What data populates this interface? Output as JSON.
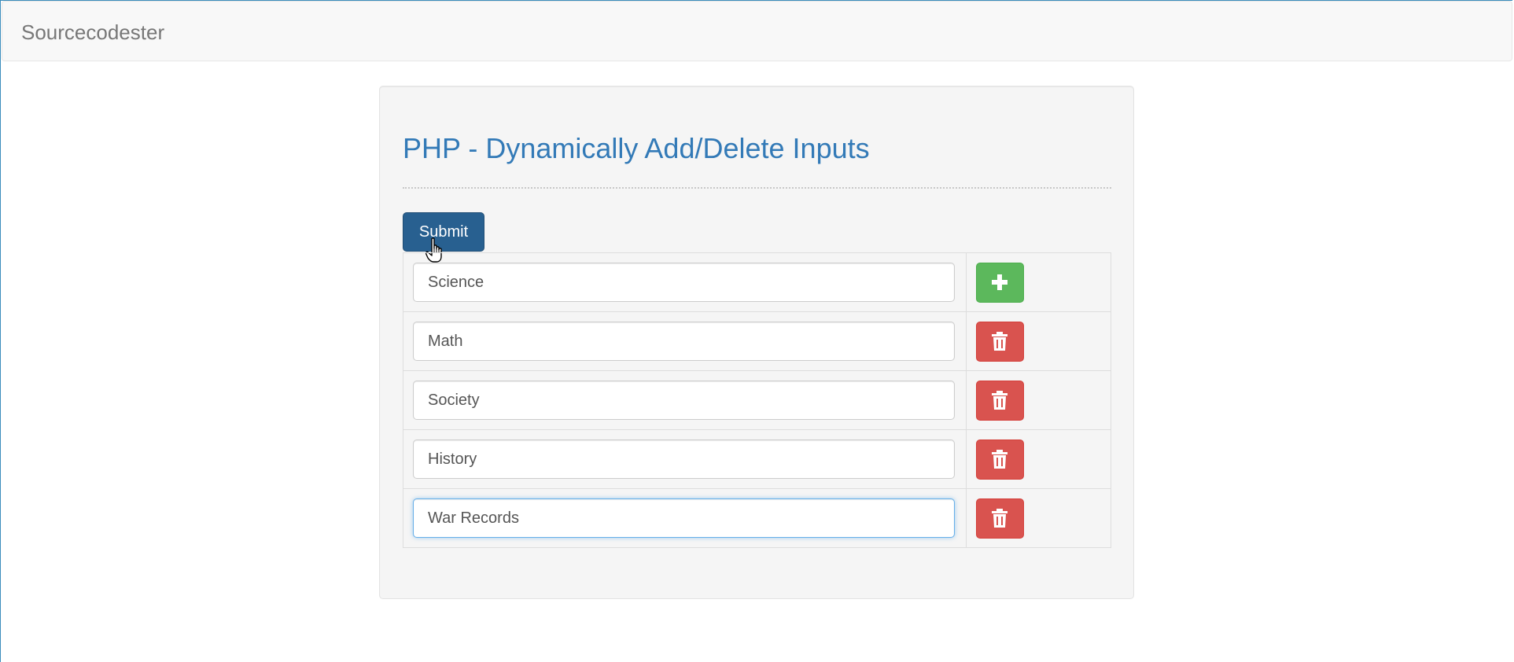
{
  "navbar": {
    "brand": "Sourcecodester"
  },
  "form": {
    "title": "PHP - Dynamically Add/Delete Inputs",
    "submit_label": "Submit",
    "rows": [
      {
        "value": "Science",
        "action": "add",
        "icon": "plus-icon",
        "color": "#5cb85c"
      },
      {
        "value": "Math",
        "action": "delete",
        "icon": "trash-icon",
        "color": "#d9534f"
      },
      {
        "value": "Society",
        "action": "delete",
        "icon": "trash-icon",
        "color": "#d9534f"
      },
      {
        "value": "History",
        "action": "delete",
        "icon": "trash-icon",
        "color": "#d9534f"
      },
      {
        "value": "War Records",
        "action": "delete",
        "icon": "trash-icon",
        "color": "#d9534f",
        "focused": true
      }
    ]
  },
  "colors": {
    "primary": "#286090",
    "title": "#337ab7",
    "success": "#5cb85c",
    "danger": "#d9534f",
    "focus": "#66afe9"
  }
}
